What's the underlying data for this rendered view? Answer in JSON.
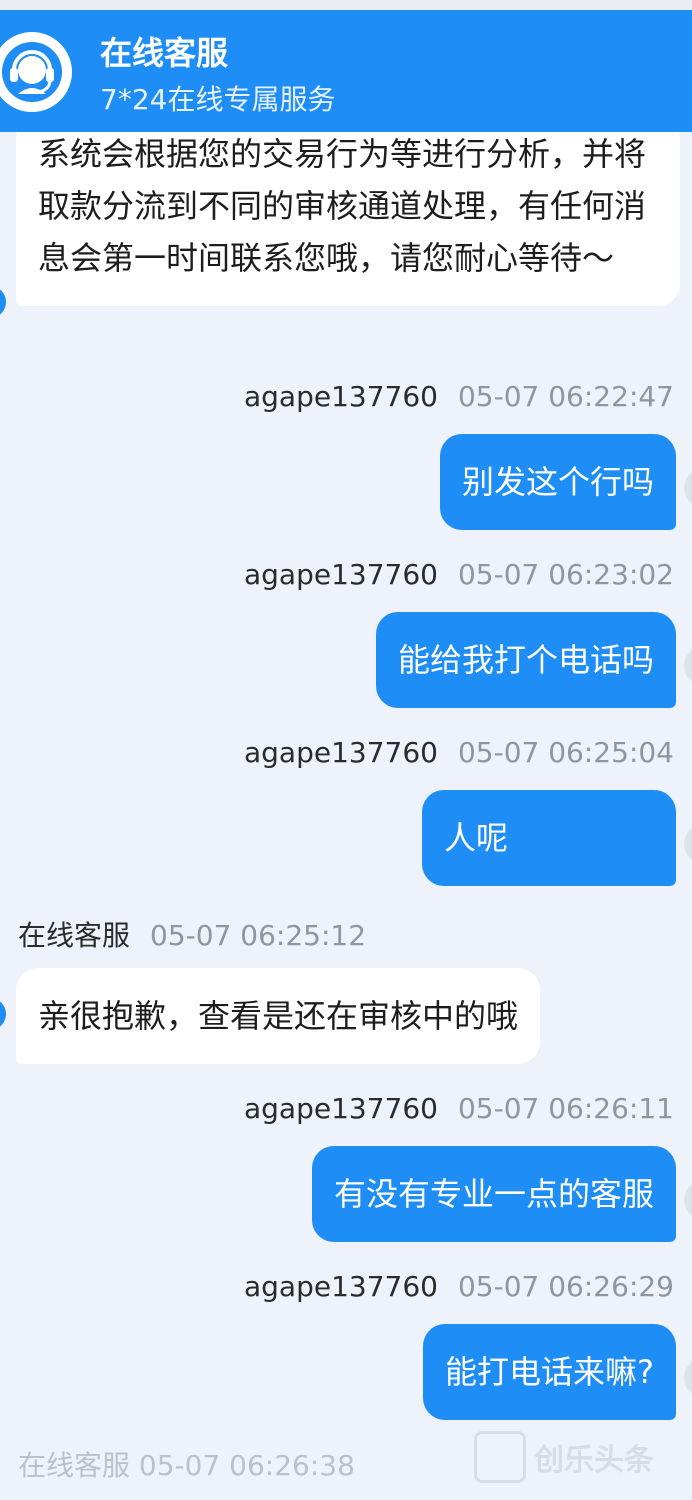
{
  "header": {
    "title": "在线客服",
    "subtitle": "7*24在线专属服务"
  },
  "messages": [
    {
      "direction": "in",
      "text": "系统会根据您的交易行为等进行分析，并将取款分流到不同的审核通道处理，有任何消息会第一时间联系您哦，请您耐心等待～"
    },
    {
      "sender": "agape137760",
      "time": "05-07 06:22:47",
      "direction": "out",
      "text": "别发这个行吗"
    },
    {
      "sender": "agape137760",
      "time": "05-07 06:23:02",
      "direction": "out",
      "text": "能给我打个电话吗"
    },
    {
      "sender": "agape137760",
      "time": "05-07 06:25:04",
      "direction": "out",
      "text": "人呢"
    },
    {
      "sender": "在线客服",
      "time": "05-07 06:25:12",
      "direction": "in",
      "text": "亲很抱歉，查看是还在审核中的哦"
    },
    {
      "sender": "agape137760",
      "time": "05-07 06:26:11",
      "direction": "out",
      "text": "有没有专业一点的客服"
    },
    {
      "sender": "agape137760",
      "time": "05-07 06:26:29",
      "direction": "out",
      "text": "能打电话来嘛?"
    }
  ],
  "partial_footer": "在线客服 05-07 06:26:38",
  "watermark": "创乐头条",
  "colors": {
    "brand": "#1e8df5",
    "background": "#eef3fb"
  }
}
